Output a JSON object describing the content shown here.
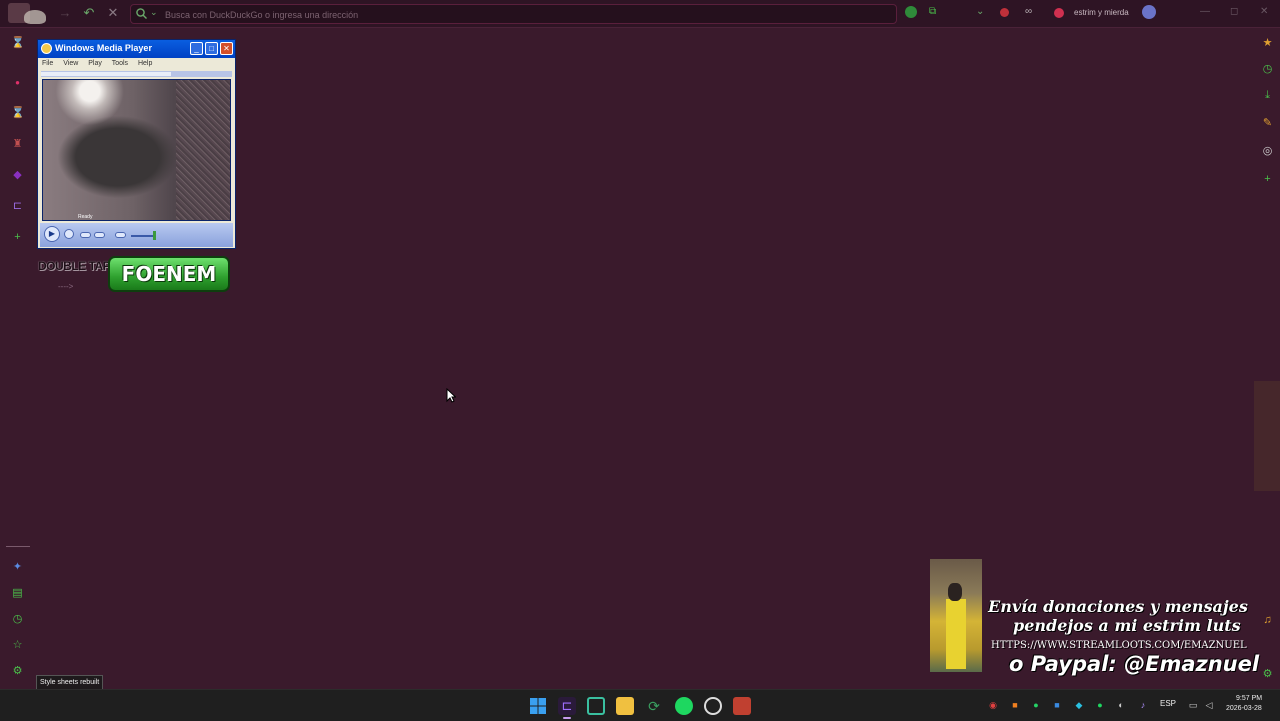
{
  "browser": {
    "url_placeholder": "Busca con DuckDuckGo o ingresa una dirección",
    "profile_label": "estrim y mierda"
  },
  "wmp": {
    "title": "Windows Media Player",
    "menu": [
      "File",
      "View",
      "Play",
      "Tools",
      "Help"
    ],
    "status": "Ready",
    "volume_level": 0.75
  },
  "overlay": {
    "double_tap": "DOUBLE TAP",
    "foenem_label": "FOENEM",
    "donate_line1": "Envía donaciones y mensajes",
    "donate_line2": "pendejos a mi estrim luts",
    "donate_url": "HTTPS://WWW.STREAMLOOTS.COM/EMAZNUEL",
    "donate_paypal": "o Paypal: @Emaznuel"
  },
  "tooltip": "Style sheets rebuilt",
  "taskbar": {
    "lang": "ESP",
    "time": "9:57 PM",
    "date": "2026-03-28"
  },
  "colors": {
    "background": "#3a1a2c",
    "accent_green": "#6aa86a",
    "taskbar": "#1f1f1f"
  }
}
